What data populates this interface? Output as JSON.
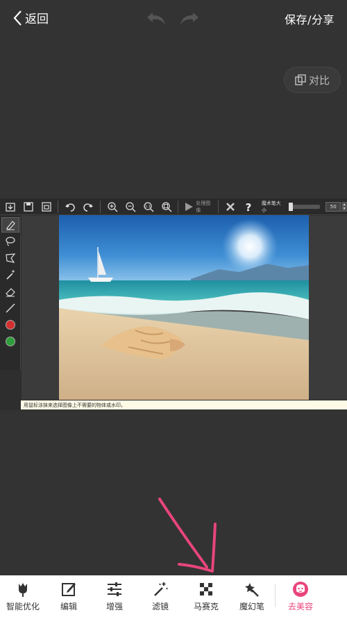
{
  "header": {
    "back_label": "返回",
    "save_label": "保存/分享"
  },
  "compare": {
    "label": "对比"
  },
  "editor": {
    "toolbar": {
      "process_label": "处理图像",
      "brush_size_label": "魔术笔大小",
      "brush_size_value": "50"
    },
    "hint_text": "用鼠标涂抹来选择图像上不需要的物体或水印。"
  },
  "bottom_nav": [
    {
      "label": "智能优化",
      "icon": "tulip-icon"
    },
    {
      "label": "编辑",
      "icon": "edit-icon"
    },
    {
      "label": "增强",
      "icon": "sliders-icon"
    },
    {
      "label": "滤镜",
      "icon": "magic-wand-icon"
    },
    {
      "label": "马赛克",
      "icon": "mosaic-icon"
    },
    {
      "label": "魔幻笔",
      "icon": "magic-pen-icon"
    },
    {
      "label": "去美容",
      "icon": "beauty-face-icon"
    }
  ],
  "colors": {
    "accent": "#e8457c",
    "arrow": "#e8457c"
  }
}
